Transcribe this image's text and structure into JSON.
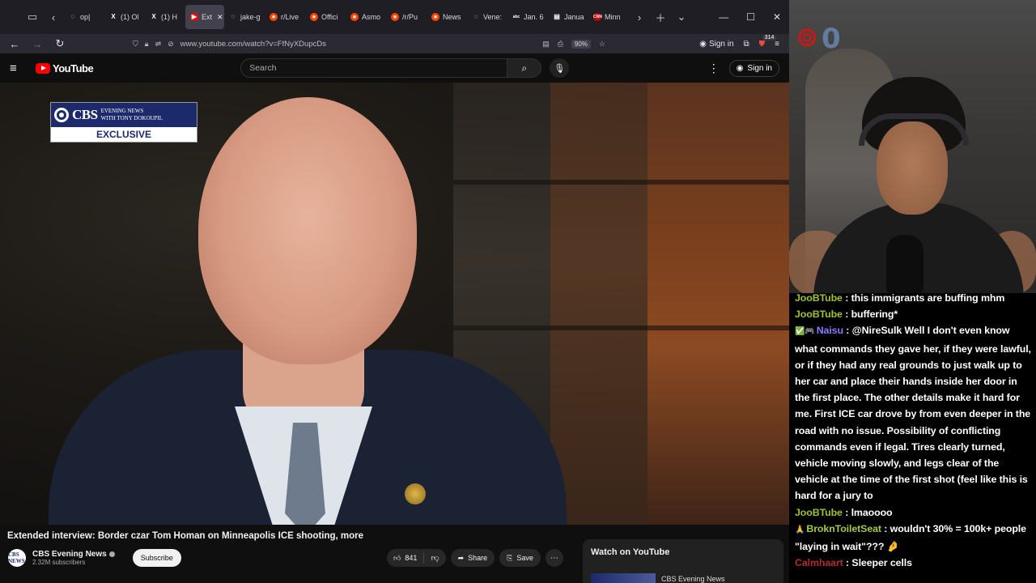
{
  "browser": {
    "tabs": [
      {
        "label": "op|",
        "favicon": "generic",
        "color": "#888888"
      },
      {
        "label": "(1) Ol",
        "favicon": "x",
        "color": "#ffffff"
      },
      {
        "label": "(1) H",
        "favicon": "x",
        "color": "#ffffff"
      },
      {
        "label": "Ext",
        "favicon": "youtube",
        "color": "#ff0000",
        "active": true
      },
      {
        "label": "jake-g",
        "favicon": "generic",
        "color": "#888888"
      },
      {
        "label": "r/Live",
        "favicon": "reddit",
        "color": "#ff4500"
      },
      {
        "label": "Offici",
        "favicon": "reddit",
        "color": "#ff4500"
      },
      {
        "label": "Asmo",
        "favicon": "reddit",
        "color": "#ff4500"
      },
      {
        "label": "/r/Pu",
        "favicon": "reddit",
        "color": "#ff4500"
      },
      {
        "label": "News",
        "favicon": "reddit",
        "color": "#ff4500"
      },
      {
        "label": "Vene:",
        "favicon": "generic",
        "color": "#c0392b"
      },
      {
        "label": "Jan. 6",
        "favicon": "abc",
        "color": "#000000"
      },
      {
        "label": "Janua",
        "favicon": "doc",
        "color": "#888888"
      },
      {
        "label": "Minn",
        "favicon": "cnn",
        "color": "#cc0000"
      }
    ],
    "url": "www.youtube.com/watch?v=FfNyXDupcDs",
    "zoom": "90%",
    "signin": "Sign in",
    "badge_count": "314"
  },
  "youtube": {
    "logo_text": "YouTube",
    "search_placeholder": "Search",
    "signin": "Sign in"
  },
  "video": {
    "overlay_brand": "CBS",
    "overlay_line1": "EVENING NEWS",
    "overlay_line2": "WITH TONY DOKOUPIL",
    "overlay_tag": "EXCLUSIVE",
    "title": "Extended interview: Border czar Tom Homan on Minneapolis ICE shooting, more",
    "channel_name": "CBS Evening News",
    "channel_avatar_text": "CBS NEWS",
    "subscribers": "2.32M subscribers",
    "subscribe_label": "Subscribe",
    "likes": "841",
    "share_label": "Share",
    "save_label": "Save",
    "watch_on_youtube": "Watch on YouTube",
    "watch_channel": "CBS Evening News"
  },
  "stream": {
    "logo_digit": "0"
  },
  "chat": [
    {
      "user": "JooBTube",
      "color": "#9ec431",
      "text": "this immigrants are buffing mhm",
      "badges": ""
    },
    {
      "user": "JooBTube",
      "color": "#9ec431",
      "text": "buffering*",
      "badges": ""
    },
    {
      "user": "Naisu",
      "color": "#8a7cff",
      "text": "@NireSulk Well I don't even know what commands they gave her, if they were lawful, or if they had any real grounds to just walk up to her car and place their hands inside her door in the first place. The other details make it hard for me. First ICE car drove by from even deeper in the road with no issue. Possibility of conflicting commands even if legal. Tires clearly turned, vehicle moving slowly, and legs clear of the vehicle at the time of the first shot (feel like this is hard for a jury to",
      "badges": "✅🎮"
    },
    {
      "user": "JooBTube",
      "color": "#9ec431",
      "text": "lmaoooo",
      "badges": ""
    },
    {
      "user": "BroknToiletSeat",
      "color": "#a6c84a",
      "text": "wouldn't 30% = 100k+ people \"laying in wait\"??? 🤌",
      "badges": "🙏"
    },
    {
      "user": "Calmhaart",
      "color": "#b02e2e",
      "text": "Sleeper cells",
      "badges": ""
    }
  ]
}
